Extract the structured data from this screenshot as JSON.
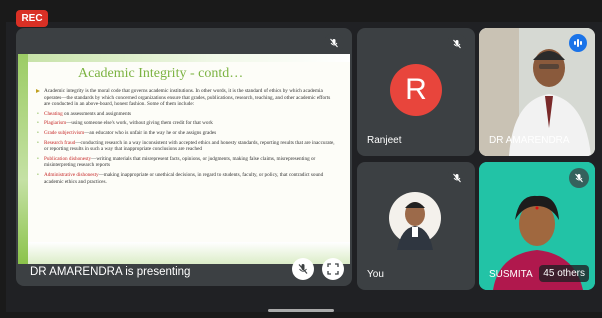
{
  "recording_badge": "REC",
  "presentation": {
    "presenter_label": "DR AMARENDRA is presenting",
    "slide": {
      "title": "Academic Integrity -       contd…",
      "intro": "Academic integrity is the moral code that governs academic institutions. In other words, it is the standard of ethics by which academia operates—the standards by which concerned organizations ensure that grades, publications, research, teaching, and other academic efforts are conducted in an above-board, honest fashion. Some of them include:",
      "items": [
        {
          "term": "Cheating",
          "text": " on assessments and assignments"
        },
        {
          "term": "Plagiarism",
          "text": "—using someone else's work, without giving them credit for that work"
        },
        {
          "term": "Grade subjectivism",
          "text": "—an educator who is unfair in the way he or she assigns grades"
        },
        {
          "term": "Research fraud",
          "text": "—conducting research in a way inconsistent with accepted ethics and honesty standards, reporting results that are inaccurate, or reporting results in such a way that inappropriate conclusions are reached"
        },
        {
          "term": "Publication dishonesty",
          "text": "—writing materials that misrepresent facts, opinions, or judgments, making false claims, misrepresenting or misinterpreting research reports"
        },
        {
          "term": "Administrative dishonesty",
          "text": "—making inappropriate or unethical decisions, in regard to students, faculty, or policy, that contradict sound academic ethics and practices."
        }
      ]
    }
  },
  "participants": [
    {
      "name": "Ranjeet",
      "avatar_letter": "R",
      "avatar_color": "#e8453c",
      "muted": true
    },
    {
      "name": "DR AMARENDRA",
      "muted": false,
      "speaking": true
    },
    {
      "name": "You",
      "muted": true
    },
    {
      "name": "SUSMITA",
      "muted": true
    }
  ],
  "others_count_label": "45 others",
  "colors": {
    "speaking_indicator": "#1a73e8",
    "rec_badge": "#d93025"
  }
}
